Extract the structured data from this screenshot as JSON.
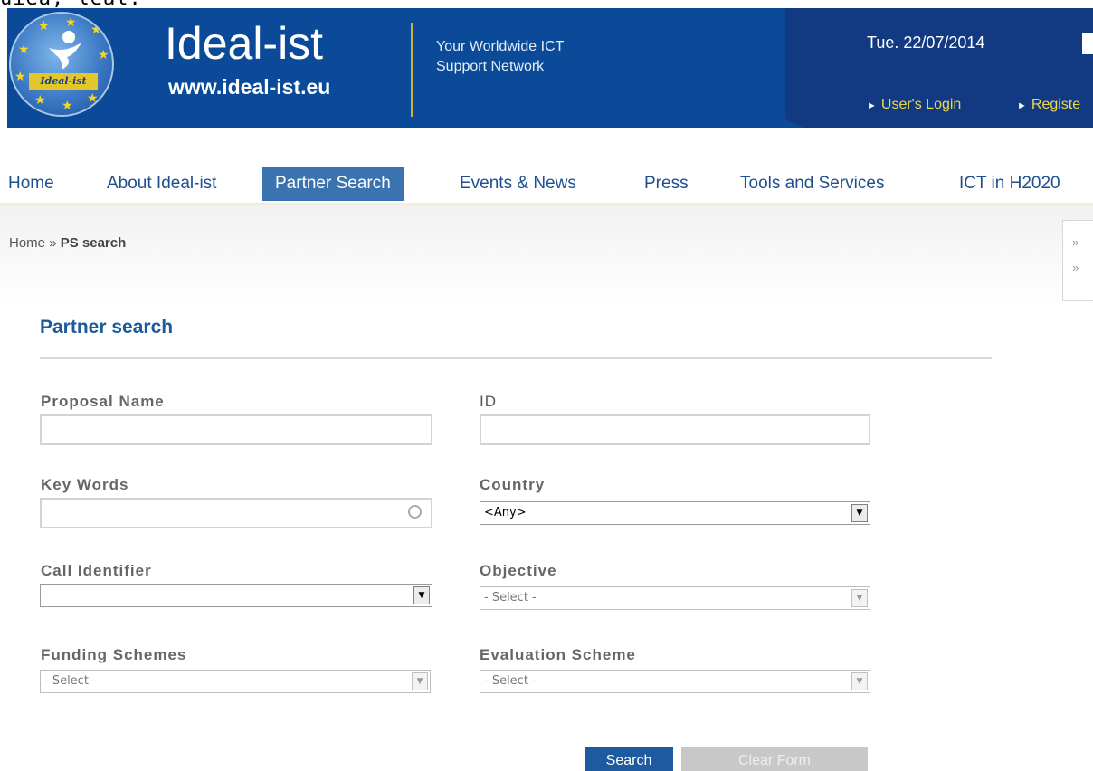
{
  "top_clip_text": "uiea, leat.",
  "header": {
    "brand": "Ideal-ist",
    "url": "www.ideal-ist.eu",
    "logo_band": "Ideal-ist",
    "tagline_line1": "Your Worldwide ICT",
    "tagline_line2": "Support Network",
    "date": "Tue. 22/07/2014",
    "login_link": "User's Login",
    "register_link": "Registe"
  },
  "nav": {
    "items": [
      "Home",
      "About Ideal-ist",
      "Partner Search",
      "Events & News",
      "Press",
      "Tools and Services",
      "ICT in H2020"
    ],
    "active": "Partner Search"
  },
  "breadcrumb": {
    "home": "Home",
    "separator": "»",
    "current": "PS search"
  },
  "form": {
    "title": "Partner search",
    "proposal_name": {
      "label": "Proposal Name",
      "value": ""
    },
    "id": {
      "label": "ID",
      "value": ""
    },
    "key_words": {
      "label": "Key Words",
      "value": ""
    },
    "country": {
      "label": "Country",
      "value": "<Any>"
    },
    "call_identifier": {
      "label": "Call Identifier",
      "value": ""
    },
    "objective": {
      "label": "Objective",
      "value": "- Select -"
    },
    "funding_schemes": {
      "label": "Funding Schemes",
      "value": "- Select -"
    },
    "evaluation_scheme": {
      "label": "Evaluation Scheme",
      "value": "- Select -"
    },
    "search_button": "Search",
    "clear_button": "Clear Form"
  },
  "colors": {
    "header_blue": "#0a4a98",
    "nav_active": "#3b73b0",
    "link_yellow": "#f0d64a",
    "title_blue": "#1d5a9a"
  }
}
